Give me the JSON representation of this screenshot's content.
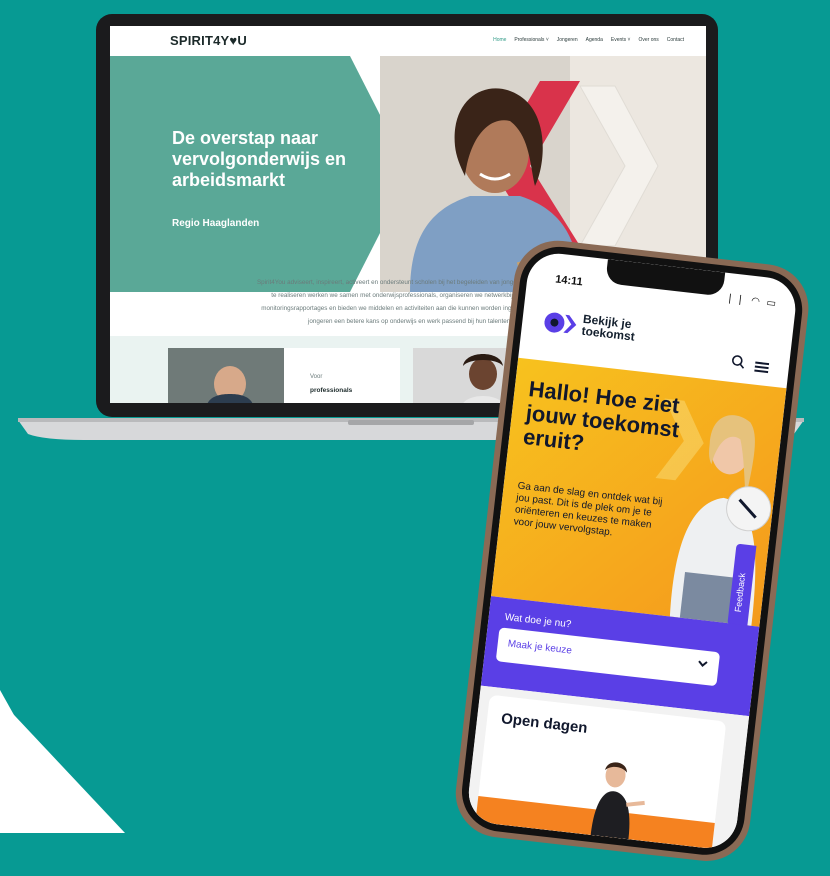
{
  "laptop_site": {
    "logo": "SPIRIT4Y♥U",
    "nav": [
      "Home",
      "Professionals ˅",
      "Jongeren",
      "Agenda",
      "Events ˅",
      "Over ons",
      "Contact"
    ],
    "hero_title": "De overstap naar vervolgonderwijs en arbeidsmarkt",
    "hero_subtitle": "Regio Haaglanden",
    "intro_lines": [
      "Spirit4You adviseert, inspireert, activeert en ondersteunt scholen bij het begeleiden van jongeren tijdens hun s",
      "te realiseren werken we samen met onderwijsprofessionals, organiseren we netwerkbijeenkomsten,",
      "monitoringsrapportages en bieden we middelen en activiteiten aan die kunnen worden ingezet tijdens de le",
      "jongeren een betere kans op onderwijs en werk passend bij hun talenten."
    ],
    "card_label_small": "Voor",
    "card_label_bold": "professionals"
  },
  "phone_app": {
    "time": "14:11",
    "status": "❘❘ ◠ ▭",
    "brand": "Bekijk je toekomst",
    "hero_heading": "Hallo! Hoe ziet jouw toekomst eruit?",
    "hero_text": "Ga aan de slag en ontdek wat bij jou past. Dit is de plek om je te oriënteren en keuzes te maken voor jouw vervolgstap.",
    "feedback": "Feedback",
    "choose_label": "Wat doe je nu?",
    "choose_value": "Maak je keuze",
    "open_days": "Open dagen"
  },
  "colors": {
    "background": "#079a93",
    "hero_teal": "#5aa897",
    "accent_red": "#d9334b",
    "phone_yellow": "#f7c21e",
    "phone_purple": "#5a3fe6",
    "phone_orange": "#f58220"
  }
}
